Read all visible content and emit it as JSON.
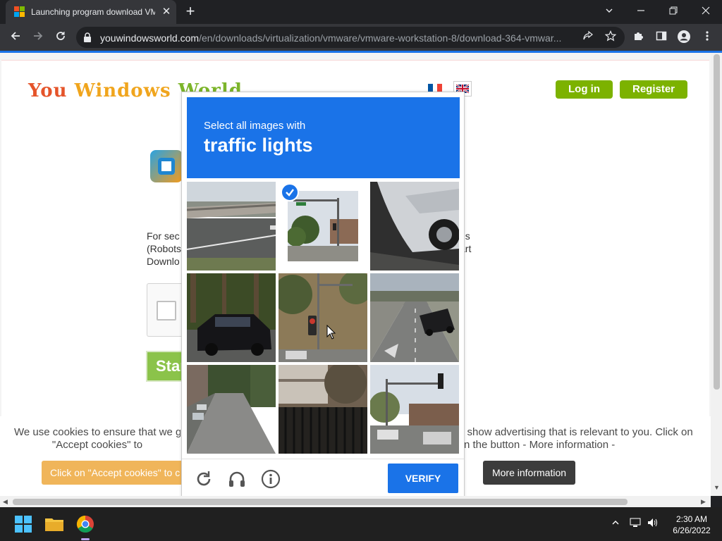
{
  "browser": {
    "tab_title": "Launching program download VMware",
    "tab_close": "✕",
    "new_tab": "+",
    "url_host": "youwindowsworld.com",
    "url_path": "/en/downloads/virtualization/vmware/vmware-workstation-8/download-364-vmwar..."
  },
  "site": {
    "logo": {
      "w1": "You ",
      "w2": "Windows ",
      "w3": "World"
    },
    "login": "Log in",
    "register": "Register",
    "para_left": "For sec (Robots Downlo",
    "para_right": "ns art",
    "start_label": "Star"
  },
  "captcha": {
    "line1": "Select all images with",
    "line2": "traffic lights",
    "verify": "VERIFY",
    "tiles": [
      {
        "scene": "overpass",
        "selected": false
      },
      {
        "scene": "traffic-light-corner",
        "selected": true
      },
      {
        "scene": "car-closeup",
        "selected": false
      },
      {
        "scene": "black-suv",
        "selected": false
      },
      {
        "scene": "traffic-light-hill",
        "selected": false
      },
      {
        "scene": "road-cars",
        "selected": false
      },
      {
        "scene": "residential-street",
        "selected": false
      },
      {
        "scene": "fence-building",
        "selected": false
      },
      {
        "scene": "traffic-light-intersection",
        "selected": false
      }
    ]
  },
  "cookies": {
    "left_line1": "We use cookies to ensure that we g",
    "left_line2": "\"Accept cookies\" to",
    "right_line1": "e show advertising that is relevant to you. Click on",
    "right_line2": "n the button - More information -",
    "accept": "Click on \"Accept cookies\" to c",
    "more_info": "More information"
  },
  "taskbar": {
    "time": "2:30 AM",
    "date": "6/26/2022"
  },
  "colors": {
    "accent": "#1a73e8",
    "site_green": "#7cb200",
    "accept_orange": "#f0b55a"
  }
}
